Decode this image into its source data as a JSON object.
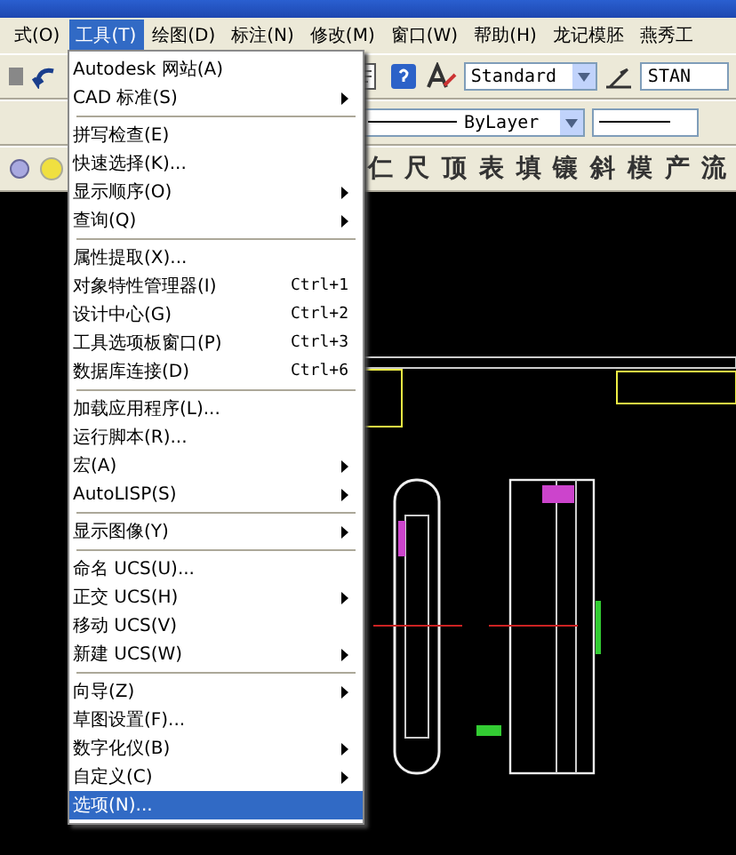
{
  "menubar": [
    {
      "label": "式(O)",
      "selected": false
    },
    {
      "label": "工具(T)",
      "selected": true
    },
    {
      "label": "绘图(D)",
      "selected": false
    },
    {
      "label": "标注(N)",
      "selected": false
    },
    {
      "label": "修改(M)",
      "selected": false
    },
    {
      "label": "窗口(W)",
      "selected": false
    },
    {
      "label": "帮助(H)",
      "selected": false
    },
    {
      "label": "龙记模胚",
      "selected": false
    },
    {
      "label": "燕秀工",
      "selected": false
    }
  ],
  "toolbar": {
    "text_style": "Standard",
    "dim_style": "STAN",
    "linetype": "ByLayer"
  },
  "tool_chars": [
    "仁",
    "尺",
    "顶",
    "表",
    "填",
    "镶",
    "斜",
    "模",
    "产",
    "流"
  ],
  "menu": [
    [
      {
        "label": "Autodesk 网站(A)",
        "submenu": false,
        "selected": false
      },
      {
        "label": "CAD 标准(S)",
        "submenu": true,
        "selected": false
      }
    ],
    [
      {
        "label": "拼写检查(E)",
        "submenu": false,
        "selected": false
      },
      {
        "label": "快速选择(K)...",
        "submenu": false,
        "selected": false
      },
      {
        "label": "显示顺序(O)",
        "submenu": true,
        "selected": false
      },
      {
        "label": "查询(Q)",
        "submenu": true,
        "selected": false
      }
    ],
    [
      {
        "label": "属性提取(X)...",
        "submenu": false,
        "selected": false
      },
      {
        "label": "对象特性管理器(I)",
        "shortcut": "Ctrl+1",
        "submenu": false,
        "selected": false
      },
      {
        "label": "设计中心(G)",
        "shortcut": "Ctrl+2",
        "submenu": false,
        "selected": false
      },
      {
        "label": "工具选项板窗口(P)",
        "shortcut": "Ctrl+3",
        "submenu": false,
        "selected": false
      },
      {
        "label": "数据库连接(D)",
        "shortcut": "Ctrl+6",
        "submenu": false,
        "selected": false
      }
    ],
    [
      {
        "label": "加载应用程序(L)...",
        "submenu": false,
        "selected": false
      },
      {
        "label": "运行脚本(R)...",
        "submenu": false,
        "selected": false
      },
      {
        "label": "宏(A)",
        "submenu": true,
        "selected": false
      },
      {
        "label": "AutoLISP(S)",
        "submenu": true,
        "selected": false
      }
    ],
    [
      {
        "label": "显示图像(Y)",
        "submenu": true,
        "selected": false
      }
    ],
    [
      {
        "label": "命名 UCS(U)...",
        "submenu": false,
        "selected": false
      },
      {
        "label": "正交 UCS(H)",
        "submenu": true,
        "selected": false
      },
      {
        "label": "移动 UCS(V)",
        "submenu": false,
        "selected": false
      },
      {
        "label": "新建 UCS(W)",
        "submenu": true,
        "selected": false
      }
    ],
    [
      {
        "label": "向导(Z)",
        "submenu": true,
        "selected": false
      },
      {
        "label": "草图设置(F)...",
        "submenu": false,
        "selected": false
      },
      {
        "label": "数字化仪(B)",
        "submenu": true,
        "selected": false
      },
      {
        "label": "自定义(C)",
        "submenu": true,
        "selected": false
      },
      {
        "label": "选项(N)...",
        "submenu": false,
        "selected": true
      }
    ]
  ]
}
